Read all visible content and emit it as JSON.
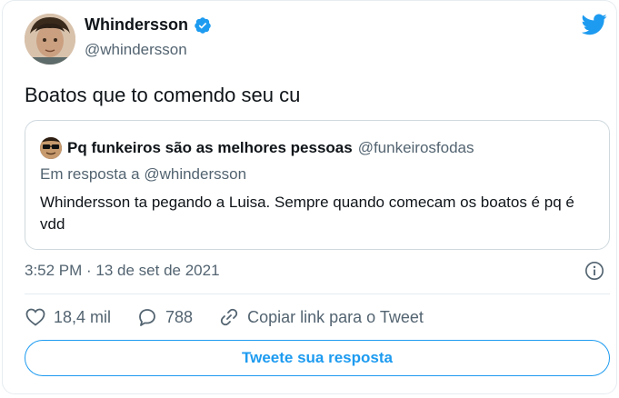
{
  "author": {
    "name": "Whindersson",
    "handle": "@whindersson",
    "verified": true
  },
  "tweet": {
    "text": "Boatos que to comendo seu cu"
  },
  "quote": {
    "name": "Pq funkeiros são as melhores pessoas",
    "handle": "@funkeirosfodas",
    "reply_to": "Em resposta a @whindersson",
    "text": "Whindersson ta pegando a Luisa. Sempre quando comecam os boatos é pq é vdd"
  },
  "timestamp": "3:52 PM · 13 de set de 2021",
  "actions": {
    "likes": "18,4 mil",
    "replies": "788",
    "copy_link": "Copiar link para o Tweet"
  },
  "reply_button": "Tweete sua resposta",
  "colors": {
    "accent": "#1d9bf0",
    "text": "#0f1419",
    "secondary": "#536471",
    "border": "#cfd9de"
  },
  "icons": [
    "twitter-bird-icon",
    "verified-badge-icon",
    "info-icon",
    "heart-icon",
    "comment-icon",
    "link-icon"
  ]
}
